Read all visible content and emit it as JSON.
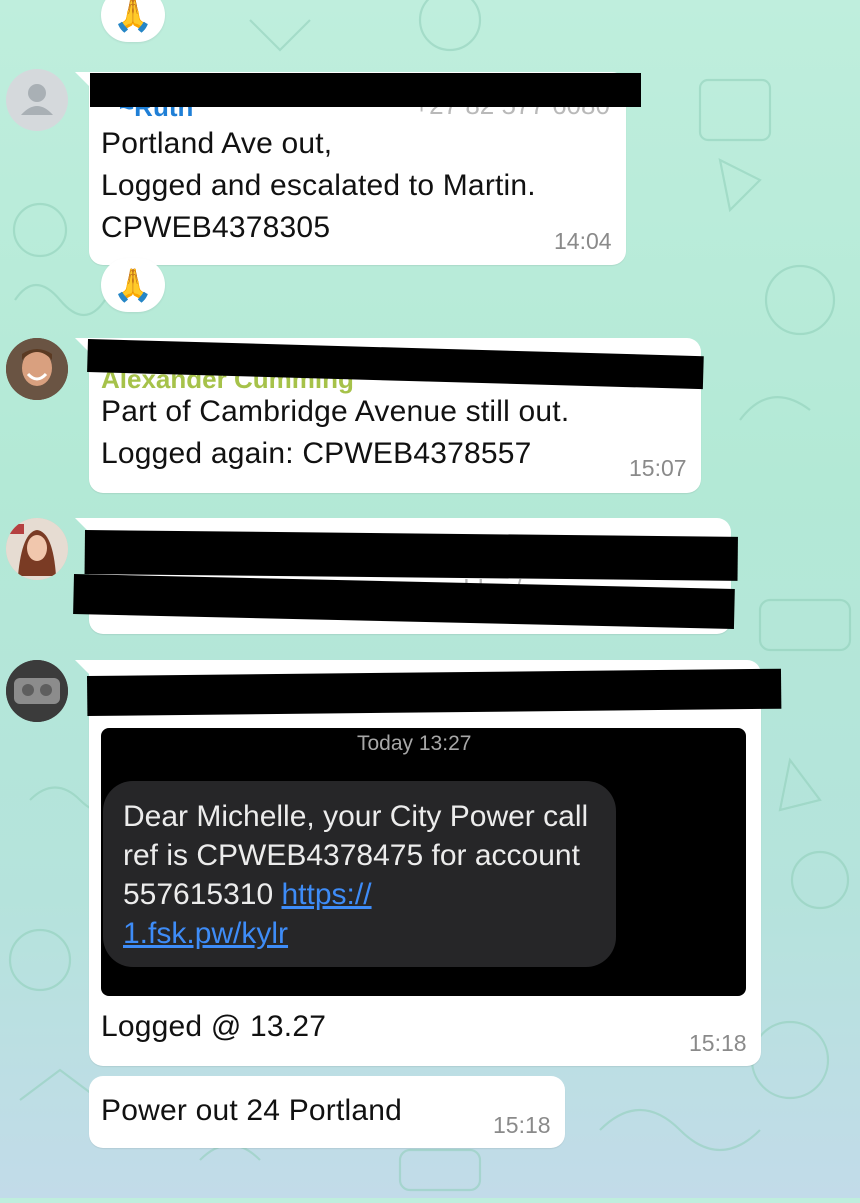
{
  "colors": {
    "background_top": "#bfeedd",
    "background_bottom": "#c2dbe9",
    "bubble": "#ffffff",
    "sender_ruth": "#1f7fd6",
    "sender_alexander": "#a6c24a",
    "timestamp": "#8a8a8a",
    "link": "#3e8cf7"
  },
  "reactions": {
    "top": "🙏",
    "ruth_message": "🙏"
  },
  "messages": {
    "ruth": {
      "sender": "~Ruth",
      "phone": "+27 82 577 6080",
      "text": "Portland Ave out,\nLogged and escalated to Martin.\nCPWEB4378305",
      "time": "14:04"
    },
    "alexander": {
      "sender": "Alexander Cumming",
      "text": "Part of Cambridge Avenue still out.\nLogged again:  CPWEB4378557",
      "time": "15:07"
    },
    "redacted_user": {
      "partial_text": "ubb.o/"
    },
    "michelle": {
      "sms_screenshot": {
        "date": "Today 13:27",
        "text": "Dear Michelle, your City Power call ref is CPWEB4378475 for account 557615310 ",
        "link": "https://1.fsk.pw/kylr",
        "link_line1": "https://",
        "link_line2": "1.fsk.pw/kylr"
      },
      "text": "Logged @ 13.27",
      "time": "15:18"
    },
    "michelle_followup": {
      "text": "Power out 24 Portland",
      "time": "15:18"
    }
  }
}
